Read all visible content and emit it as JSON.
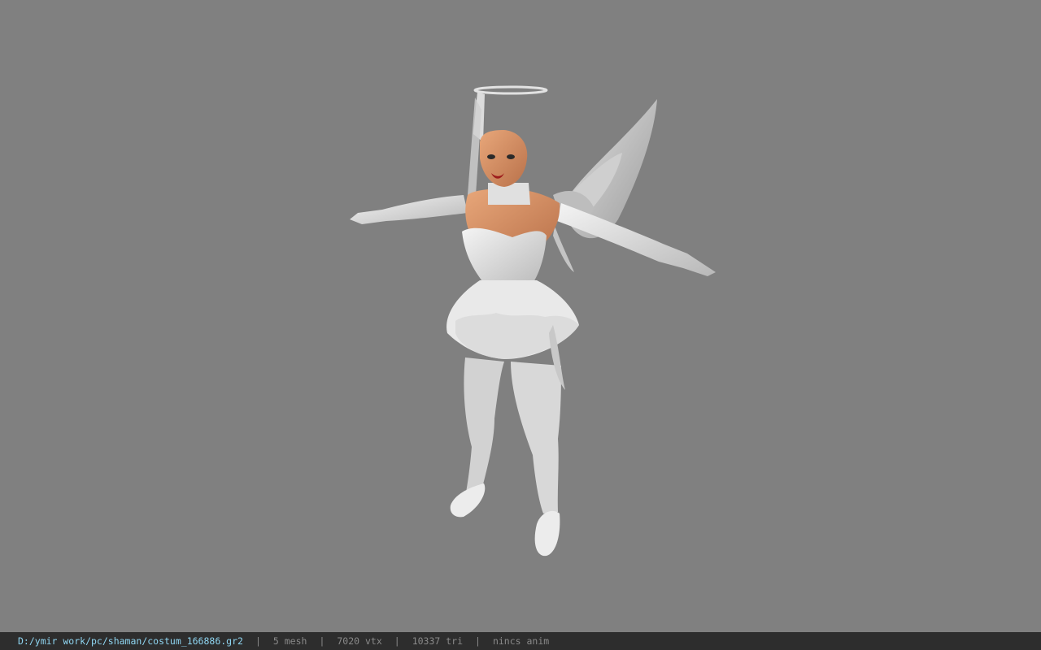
{
  "viewer": {
    "background_color": "#808080",
    "model_description_icon": "angel-character-model"
  },
  "status_bar": {
    "file_path": "D:/ymir work/pc/shaman/costum_166886.gr2",
    "separator": "|",
    "mesh": "5 mesh",
    "vertices": "7020 vtx",
    "triangles": "10337 tri",
    "animation": "nincs anim",
    "path_color": "#8fd6f2",
    "text_color": "#8a8a8a"
  }
}
